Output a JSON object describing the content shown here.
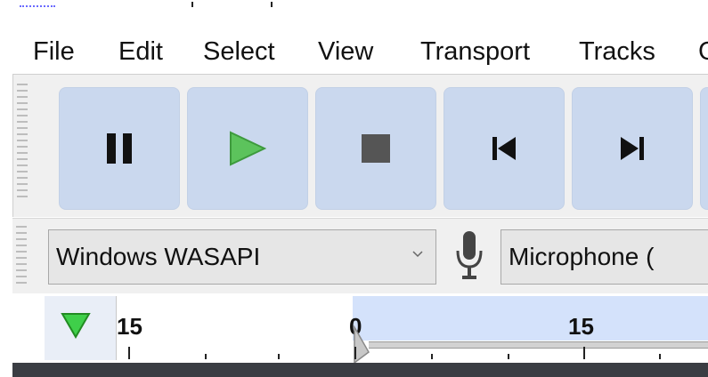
{
  "menu": {
    "items": [
      "File",
      "Edit",
      "Select",
      "View",
      "Transport",
      "Tracks"
    ]
  },
  "transport": {
    "buttons": [
      {
        "name": "pause",
        "icon": "pause-icon"
      },
      {
        "name": "play",
        "icon": "play-icon"
      },
      {
        "name": "stop",
        "icon": "stop-icon"
      },
      {
        "name": "skip-to-start",
        "icon": "skip-to-start-icon"
      },
      {
        "name": "skip-to-end",
        "icon": "skip-to-end-icon"
      }
    ],
    "colors": {
      "button_bg": "#cad8ee",
      "play_green": "#5cc35c",
      "icon_dark": "#111111"
    }
  },
  "device": {
    "host": "Windows WASAPI",
    "input": "Microphone (",
    "mic_icon": "microphone-icon"
  },
  "timeline": {
    "labels": [
      "15",
      "0",
      "15"
    ],
    "selection_color": "#d4e2fb",
    "play_head_icon": "green-triangle-icon"
  }
}
